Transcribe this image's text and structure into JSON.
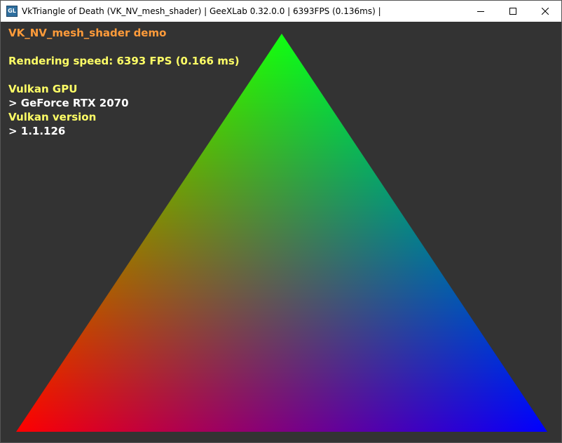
{
  "window": {
    "title": "VkTriangle of Death (VK_NV_mesh_shader) | GeeXLab 0.32.0.0 | 6393FPS (0.136ms) |",
    "icon": "geexlab-app-icon",
    "icon_glyph": "GL",
    "controls": [
      "minimize-icon",
      "maximize-icon",
      "close-icon"
    ]
  },
  "hud": {
    "demo_title": "VK_NV_mesh_shader demo",
    "rendering_speed": "Rendering speed: 6393 FPS (0.166 ms)",
    "gpu_label": "Vulkan GPU",
    "gpu_value": "> GeForce RTX 2070",
    "version_label": "Vulkan version",
    "version_value": "> 1.1.126"
  },
  "colors": {
    "background": "#333333",
    "demo_title": "#ff9b3a",
    "label": "#ffff66",
    "value": "#ffffff",
    "vertex_top": "#00ff00",
    "vertex_left": "#ff0000",
    "vertex_right": "#0000ff"
  }
}
